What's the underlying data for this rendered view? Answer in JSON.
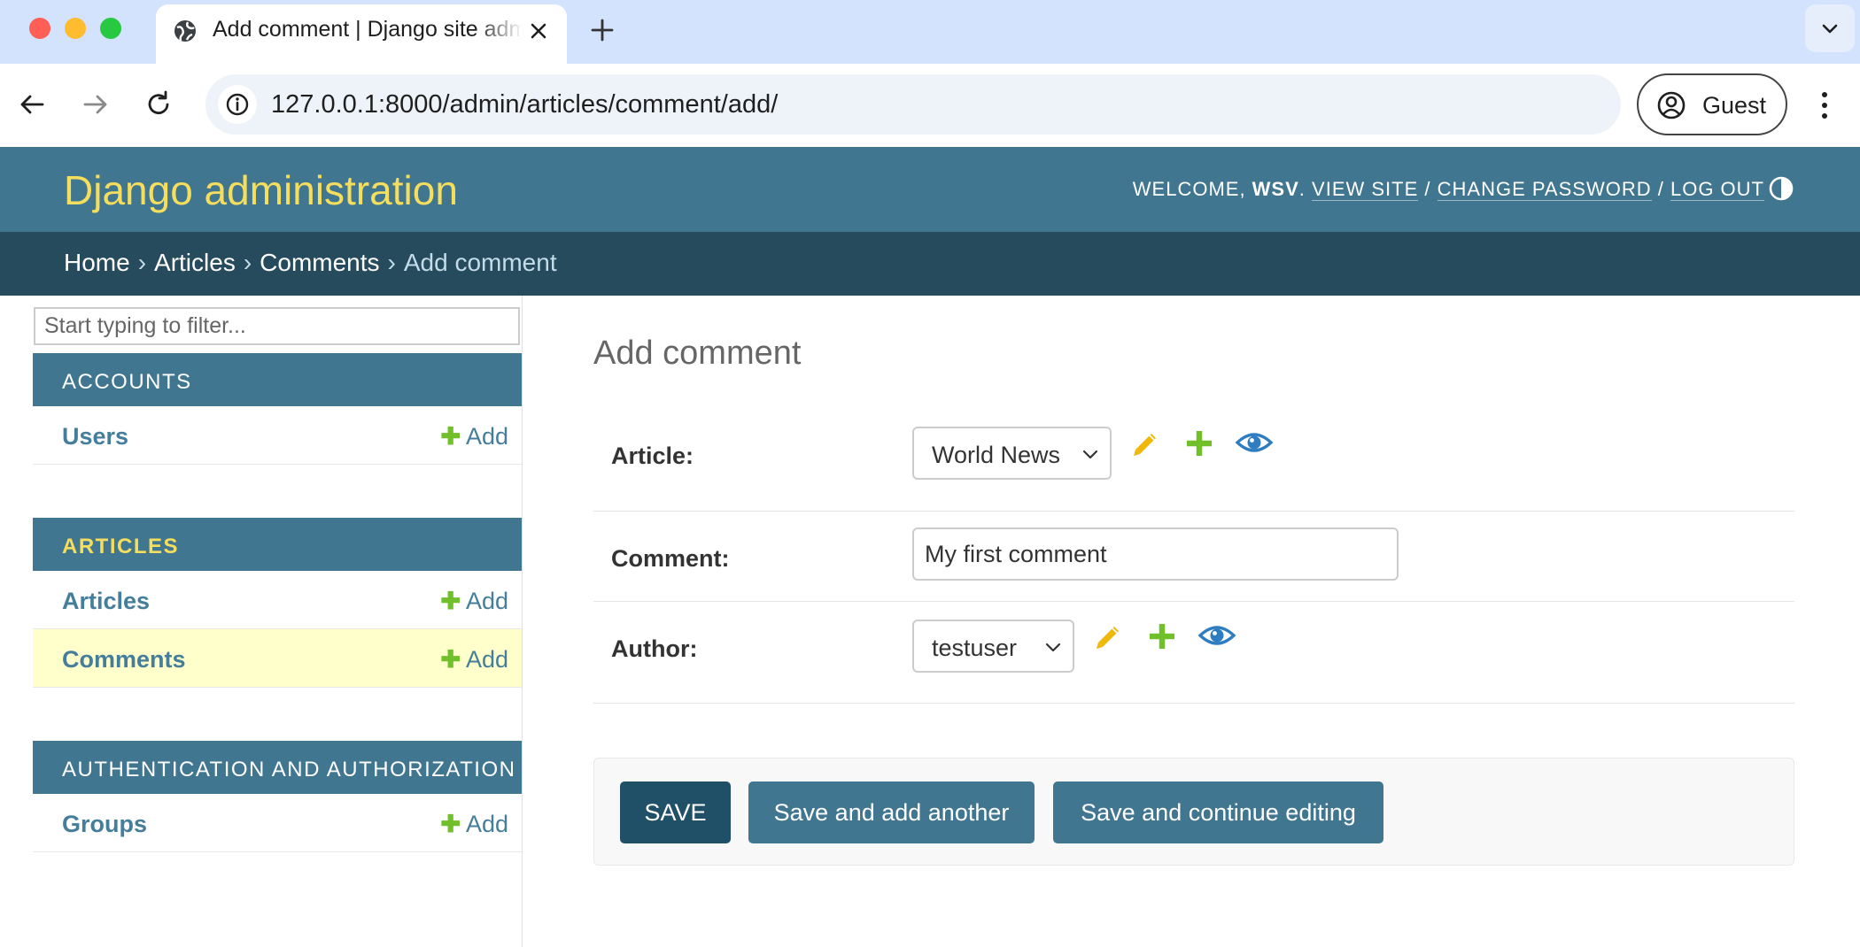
{
  "browser": {
    "tab_title": "Add comment | Django site admin",
    "url": "127.0.0.1:8000/admin/articles/comment/add/",
    "profile_label": "Guest"
  },
  "header": {
    "site_name": "Django administration",
    "welcome": "WELCOME, ",
    "username": "WSV",
    "view_site": "VIEW SITE",
    "change_password": "CHANGE PASSWORD",
    "log_out": "LOG OUT",
    "separator": "/"
  },
  "breadcrumbs": {
    "home": "Home",
    "app": "Articles",
    "model": "Comments",
    "current": "Add comment",
    "separator": "›"
  },
  "sidebar": {
    "filter_placeholder": "Start typing to filter...",
    "add_label": "Add",
    "modules": [
      {
        "caption": "ACCOUNTS",
        "models": [
          {
            "name": "Users"
          }
        ]
      },
      {
        "caption": "ARTICLES",
        "models": [
          {
            "name": "Articles"
          },
          {
            "name": "Comments"
          }
        ]
      },
      {
        "caption": "AUTHENTICATION AND AUTHORIZATION",
        "models": [
          {
            "name": "Groups"
          }
        ]
      }
    ]
  },
  "form": {
    "title": "Add comment",
    "article": {
      "label": "Article:",
      "selected": "World News"
    },
    "comment": {
      "label": "Comment:",
      "value": "My first comment"
    },
    "author": {
      "label": "Author:",
      "selected": "testuser"
    }
  },
  "buttons": {
    "save": "SAVE",
    "save_add_another": "Save and add another",
    "save_continue": "Save and continue editing"
  },
  "colors": {
    "header_bg": "#417690",
    "breadcrumb_bg": "#264b5d",
    "site_name": "#f5dd5d",
    "add_plus": "#70bf2b",
    "edit_pencil": "#efb80b",
    "view_eye": "#2f7dc1",
    "current_row": "#ffffcc"
  }
}
